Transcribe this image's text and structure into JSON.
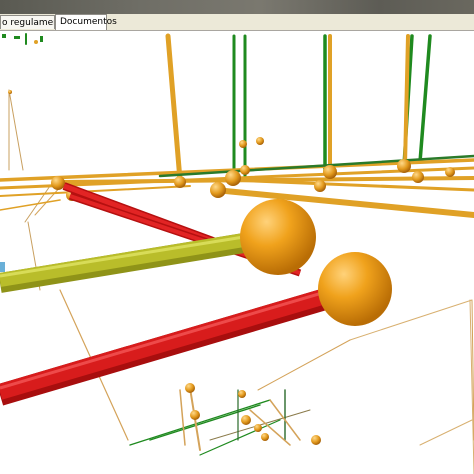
{
  "tabs": [
    {
      "label": "o regulamentar"
    },
    {
      "label": "Documentos"
    }
  ],
  "colors": {
    "pipe_orange": "#e0a126",
    "pipe_green": "#1f8a1f",
    "pipe_red": "#d81c1c",
    "pipe_yellowgreen": "#b9bd2a",
    "node_sphere": "#f0a21c"
  }
}
